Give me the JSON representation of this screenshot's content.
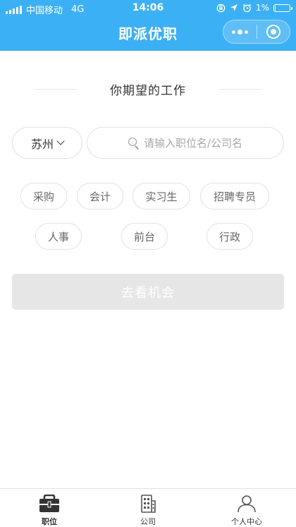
{
  "status_bar": {
    "carrier": "中国移动",
    "network": "4G",
    "time": "14:06",
    "battery_percent": "1%",
    "battery_level": 0.01
  },
  "nav": {
    "title": "即派优职"
  },
  "section": {
    "title": "你期望的工作"
  },
  "search": {
    "city": "苏州",
    "placeholder": "请输入职位名/公司名"
  },
  "tags": [
    "采购",
    "会计",
    "实习生",
    "招聘专员",
    "人事",
    "前台",
    "行政"
  ],
  "go_button": {
    "label": "去看机会"
  },
  "tabbar": {
    "items": [
      {
        "label": "职位",
        "icon": "briefcase-icon",
        "active": true
      },
      {
        "label": "公司",
        "icon": "building-icon",
        "active": false
      },
      {
        "label": "个人中心",
        "icon": "person-icon",
        "active": false
      }
    ]
  },
  "colors": {
    "header": "#3cb0f5",
    "button_disabled": "#e6e6e6"
  }
}
